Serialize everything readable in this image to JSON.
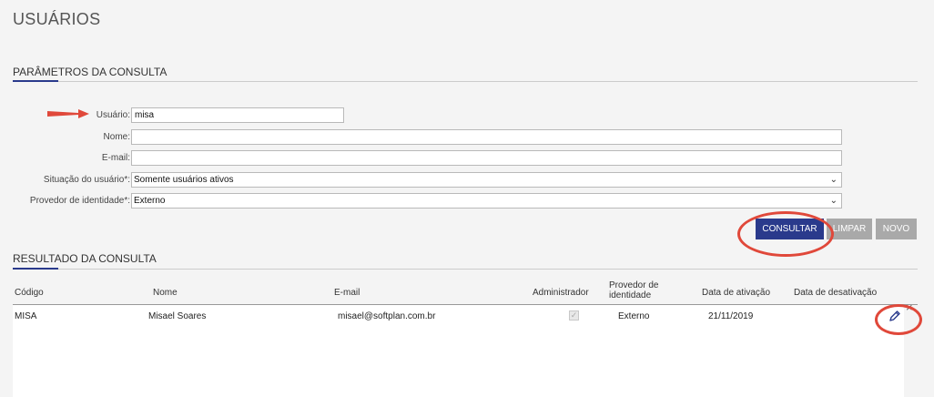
{
  "page": {
    "title": "USUÁRIOS"
  },
  "params": {
    "title": "PARÂMETROS DA CONSULTA",
    "usuario": {
      "label": "Usuário:",
      "value": "misa"
    },
    "nome": {
      "label": "Nome:",
      "value": ""
    },
    "email": {
      "label": "E-mail:",
      "value": ""
    },
    "situacao": {
      "label": "Situação do usuário*:",
      "value": "Somente usuários ativos"
    },
    "provedor": {
      "label": "Provedor de identidade*:",
      "value": "Externo"
    }
  },
  "actions": {
    "consultar": "CONSULTAR",
    "limpar": "LIMPAR",
    "novo": "NOVO"
  },
  "results": {
    "title": "RESULTADO DA CONSULTA",
    "columns": {
      "codigo": "Código",
      "nome": "Nome",
      "email": "E-mail",
      "administrador": "Administrador",
      "provedor_line1": "Provedor de",
      "provedor_line2": "identidade",
      "ativacao": "Data de ativação",
      "desativacao": "Data de desativação"
    },
    "rows": [
      {
        "codigo": "MISA",
        "nome": "Misael Soares",
        "email": "misael@softplan.com.br",
        "administrador": true,
        "provedor": "Externo",
        "ativacao": "21/11/2019",
        "desativacao": ""
      }
    ]
  },
  "icons": {
    "edit": "pencil-icon",
    "close": "close-icon",
    "arrow": "arrow-pointer",
    "dropdown": "chevron-down-icon"
  },
  "colors": {
    "primary": "#2a3a8c",
    "highlight": "#e0483a",
    "disabled": "#a9a9a9"
  }
}
